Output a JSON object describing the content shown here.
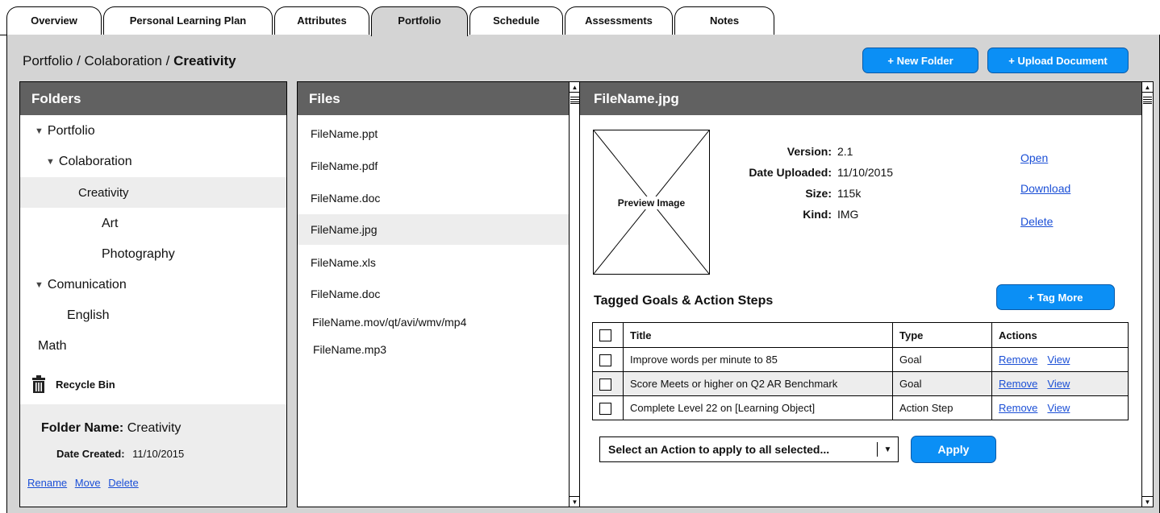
{
  "tabs": [
    {
      "label": "Overview",
      "active": false
    },
    {
      "label": "Personal Learning Plan",
      "active": false
    },
    {
      "label": "Attributes",
      "active": false
    },
    {
      "label": "Portfolio",
      "active": true
    },
    {
      "label": "Schedule",
      "active": false
    },
    {
      "label": "Assessments",
      "active": false
    },
    {
      "label": "Notes",
      "active": false
    }
  ],
  "breadcrumb": {
    "part1": "Portfolio / Colaboration /",
    "current": "Creativity"
  },
  "toolbar": {
    "new_folder": "+ New Folder",
    "upload": "+ Upload Document"
  },
  "folders": {
    "title": "Folders",
    "tree": {
      "portfolio": "Portfolio",
      "colaboration": "Colaboration",
      "creativity": "Creativity",
      "art": "Art",
      "photography": "Photography",
      "comunication": "Comunication",
      "english": "English",
      "math": "Math"
    },
    "recycle_bin": "Recycle Bin",
    "info": {
      "name_label": "Folder Name:",
      "name_value": "Creativity",
      "date_label": "Date Created:",
      "date_value": "11/10/2015",
      "rename": "Rename",
      "move": "Move",
      "delete": "Delete"
    }
  },
  "files": {
    "title": "Files",
    "items": [
      "FileName.ppt",
      "FileName.pdf",
      "FileName.doc",
      "FileName.jpg",
      "FileName.xls",
      "FileName.doc",
      "FileName.mov/qt/avi/wmv/mp4",
      "FileName.mp3"
    ],
    "selected_index": 3
  },
  "detail": {
    "title": "FileName.jpg",
    "preview_label": "Preview Image",
    "meta": {
      "version_label": "Version:",
      "version": "2.1",
      "date_label": "Date Uploaded:",
      "date": "11/10/2015",
      "size_label": "Size:",
      "size": "115k",
      "kind_label": "Kind:",
      "kind": "IMG"
    },
    "actions": {
      "open": "Open",
      "download": "Download",
      "delete": "Delete"
    },
    "tagged_title": "Tagged Goals & Action Steps",
    "tag_more": "+ Tag More",
    "table": {
      "headers": {
        "title": "Title",
        "type": "Type",
        "actions": "Actions"
      },
      "rows": [
        {
          "title": "Improve words per minute to 85",
          "type": "Goal",
          "remove": "Remove",
          "view": "View"
        },
        {
          "title": "Score Meets or higher on Q2 AR Benchmark",
          "type": "Goal",
          "remove": "Remove",
          "view": "View"
        },
        {
          "title": "Complete Level 22 on [Learning Object]",
          "type": "Action Step",
          "remove": "Remove",
          "view": "View"
        }
      ]
    },
    "bulk_select": "Select an Action to apply to all selected...",
    "apply": "Apply"
  }
}
